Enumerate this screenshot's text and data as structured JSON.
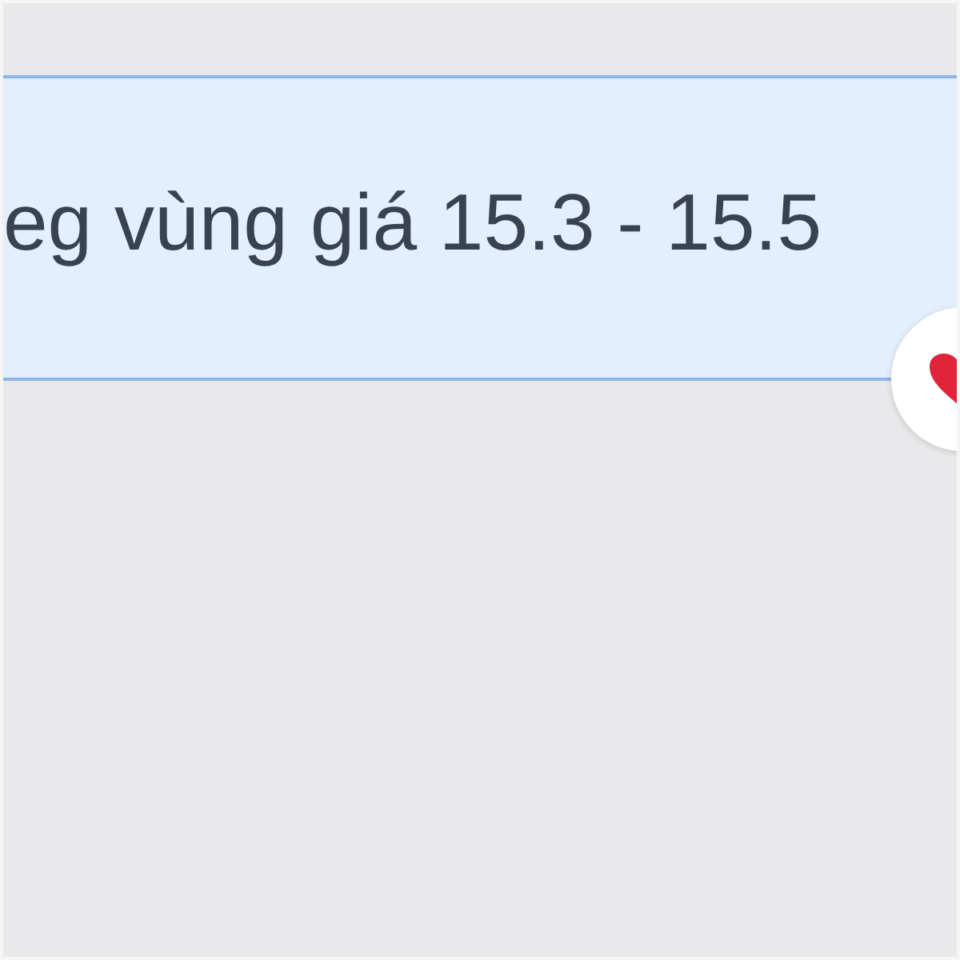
{
  "message": {
    "text": "eg vùng giá 15.3 - 15.5",
    "reaction": {
      "kind": "heart"
    }
  }
}
